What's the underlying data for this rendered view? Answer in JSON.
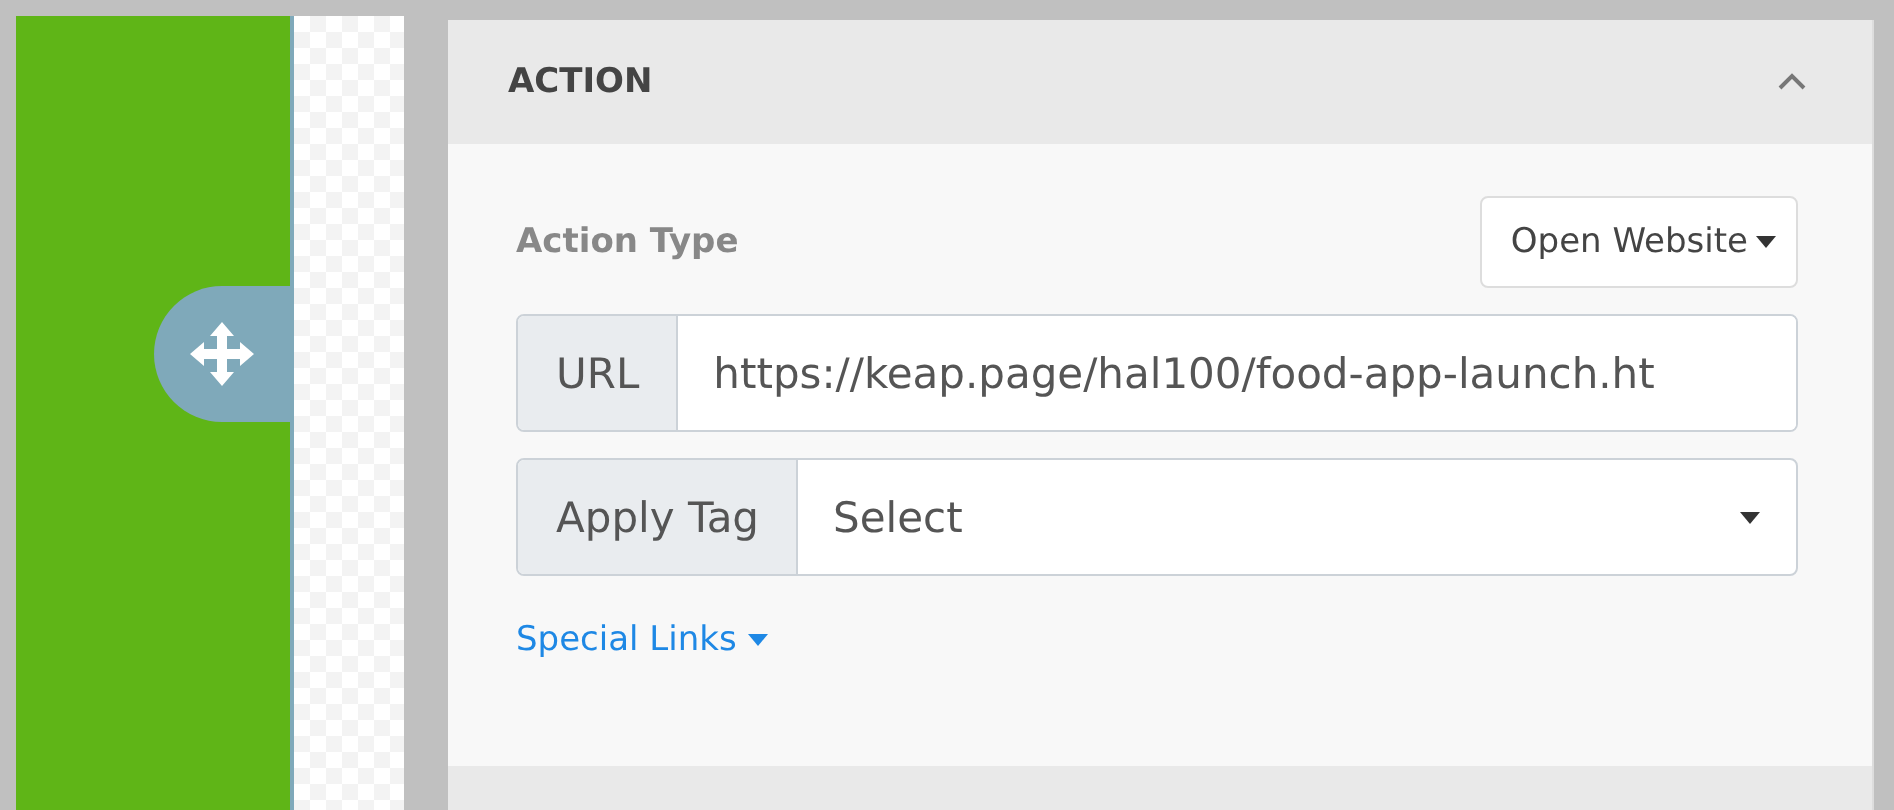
{
  "section": {
    "title": "ACTION",
    "expanded": true
  },
  "action_type": {
    "label": "Action Type",
    "value": "Open Website"
  },
  "url": {
    "addon": "URL",
    "value": "https://keap.page/hal100/food-app-launch.ht"
  },
  "apply_tag": {
    "addon": "Apply Tag",
    "placeholder": "Select"
  },
  "special_links": {
    "label": "Special Links"
  }
}
